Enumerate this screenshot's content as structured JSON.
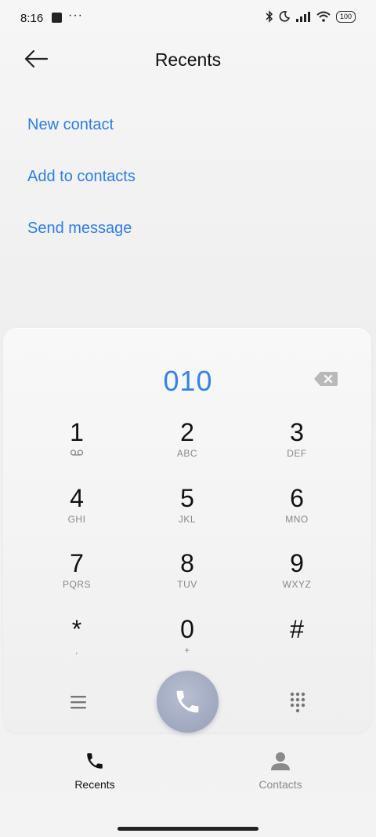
{
  "status_bar": {
    "time": "8:16",
    "more_indicator": "···",
    "battery": "100",
    "icons": [
      "app-square-icon",
      "bluetooth-icon",
      "moon-icon",
      "signal-icon",
      "wifi-icon",
      "battery-icon"
    ]
  },
  "header": {
    "title": "Recents",
    "back_icon": "arrow-left-icon"
  },
  "actions": [
    {
      "label": "New contact"
    },
    {
      "label": "Add to contacts"
    },
    {
      "label": "Send message"
    }
  ],
  "dialpad": {
    "number": "010",
    "keys": [
      {
        "digit": "1",
        "letters": ""
      },
      {
        "digit": "2",
        "letters": "ABC"
      },
      {
        "digit": "3",
        "letters": "DEF"
      },
      {
        "digit": "4",
        "letters": "GHI"
      },
      {
        "digit": "5",
        "letters": "JKL"
      },
      {
        "digit": "6",
        "letters": "MNO"
      },
      {
        "digit": "7",
        "letters": "PQRS"
      },
      {
        "digit": "8",
        "letters": "TUV"
      },
      {
        "digit": "9",
        "letters": "WXYZ"
      },
      {
        "digit": "*",
        "letters": ","
      },
      {
        "digit": "0",
        "letters": "+"
      },
      {
        "digit": "#",
        "letters": ""
      }
    ]
  },
  "bottom_nav": [
    {
      "label": "Recents",
      "icon": "phone-icon",
      "active": true
    },
    {
      "label": "Contacts",
      "icon": "person-icon",
      "active": false
    }
  ],
  "colors": {
    "accent": "#2f7de1",
    "number": "#3683e4",
    "call_button": "#a3abc2",
    "muted": "#888888"
  }
}
